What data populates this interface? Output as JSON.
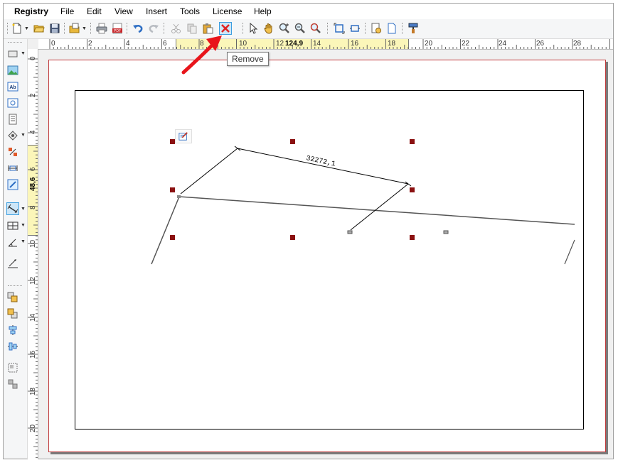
{
  "menu": {
    "app_name": "Registry",
    "items": [
      "File",
      "Edit",
      "View",
      "Insert",
      "Tools",
      "License",
      "Help"
    ]
  },
  "toolbar": {
    "tooltip": "Remove",
    "icons": [
      "new-document-icon",
      "open-folder-icon",
      "save-icon",
      "template-icon",
      "print-icon",
      "pdf-export-icon",
      "undo-icon",
      "redo-icon",
      "cut-icon",
      "copy-icon",
      "paste-icon",
      "remove-icon",
      "select-arrow-icon",
      "pan-hand-icon",
      "zoom-in-icon",
      "zoom-out-icon",
      "zoom-magnify-icon",
      "fit-page-icon",
      "fit-width-icon",
      "page-setup-icon",
      "page-icon",
      "format-painter-icon"
    ]
  },
  "rulers": {
    "horizontal_labels": [
      "0",
      "2",
      "4",
      "6",
      "8",
      "10",
      "12",
      "14",
      "16",
      "18",
      "20",
      "22",
      "24",
      "26",
      "28"
    ],
    "horizontal_readout": "124,9",
    "vertical_labels": [
      "0",
      "2",
      "4",
      "6",
      "8",
      "10",
      "12",
      "14",
      "16",
      "18",
      "20"
    ],
    "vertical_readout": "48,6"
  },
  "drawing": {
    "dimension_text": "32272,1"
  },
  "colors": {
    "handle": "#8b1111",
    "page_border": "#c0393b",
    "arrow": "#e8151b",
    "ruler_highlight": "#fbf6b9",
    "active_button": "#cde6f7"
  }
}
